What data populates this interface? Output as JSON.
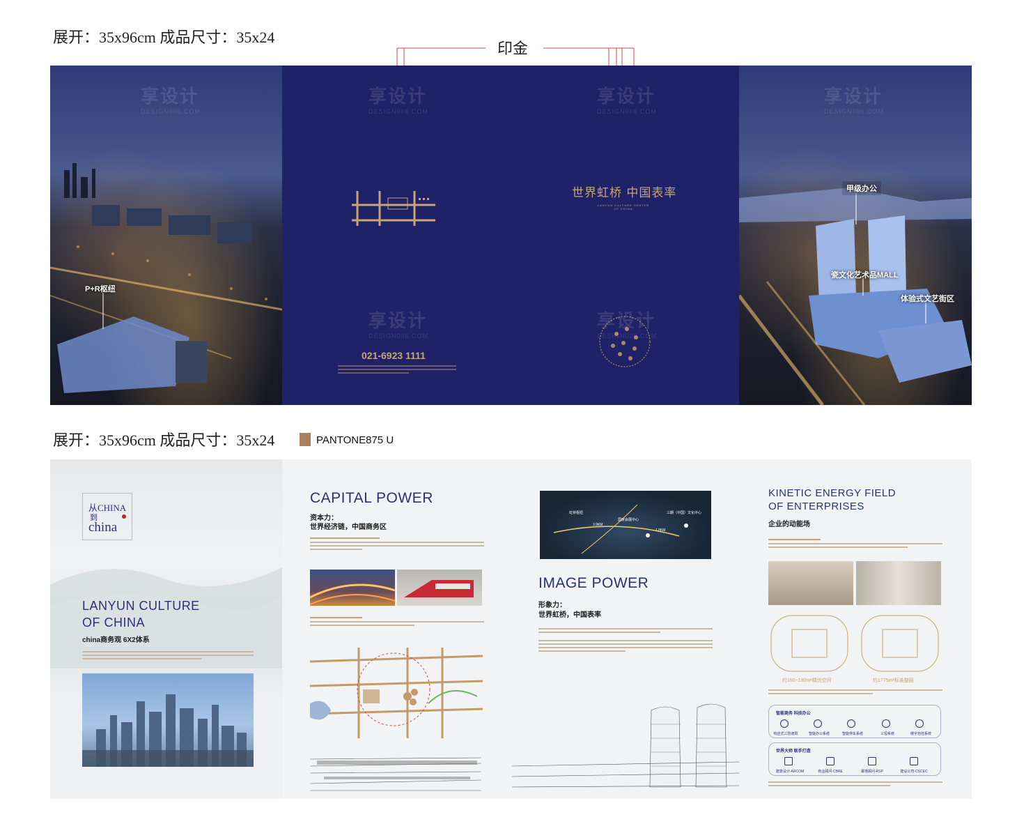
{
  "spec_top": "展开：35x96cm  成品尺寸：35x24",
  "spec_bottom": "展开：35x96cm  成品尺寸：35x24",
  "gold_foil_label": "印金",
  "pantone_label": "PANTONE875 U",
  "watermark": {
    "cn": "享设计",
    "en": "DESIGN006.COM"
  },
  "top": {
    "left_panel": {
      "tag": "P+R枢纽"
    },
    "inner_left": {
      "phone": "021-6923 1111"
    },
    "inner_right": {
      "slogan": "世界虹桥 中国表率",
      "sub_en_1": "LANYUN CULTURE CENTER",
      "sub_en_2": "OF CHINA"
    },
    "right_panel": {
      "tag_1": "甲级办公",
      "tag_2": "瓷文化艺术品MALL",
      "tag_3": "体验式文艺街区"
    }
  },
  "bottom": {
    "panel1": {
      "logo_line1": "从CHINA",
      "logo_line2": "到",
      "logo_line3": "china",
      "title_1": "LANYUN CULTURE",
      "title_2": "OF CHINA",
      "subtitle": "china商务观  6X2体系"
    },
    "panel2": {
      "title": "CAPITAL POWER",
      "sub_1": "资本力：",
      "sub_2": "世界经济链，中国商务区"
    },
    "panel3": {
      "title": "IMAGE POWER",
      "sub_1": "形象力：",
      "sub_2": "世界虹桥，中国表率",
      "map_labels": [
        "虹桥枢纽",
        "国家会展中心",
        "三朗（中国）文化中心",
        "3.9KM",
        "1.8KM"
      ]
    },
    "panel4": {
      "title_1": "KINETIC ENERGY FIELD",
      "title_2": "OF ENTERPRISES",
      "subtitle": "企业的动能场",
      "plan_1": "约160~180m²精优空间",
      "plan_2": "约1775m²标准整层",
      "box1_title": "智能商务  科技办公",
      "box1_items": [
        "响应式三防遮阳",
        "智能办公系统",
        "智能停车系统",
        "三恒系统",
        "楼宇自控系统"
      ],
      "box2_title": "世界大师  联手打造",
      "box2_items": [
        "建筑设计-ARCOM",
        "商业顾问-CBRE",
        "幕墙顾问-RSP",
        "建设公司-CSCEC"
      ]
    }
  },
  "colors": {
    "navy": "#1f2266",
    "gold": "#c8a474",
    "title_blue": "#2b3178",
    "pantone": "#a9805e"
  }
}
